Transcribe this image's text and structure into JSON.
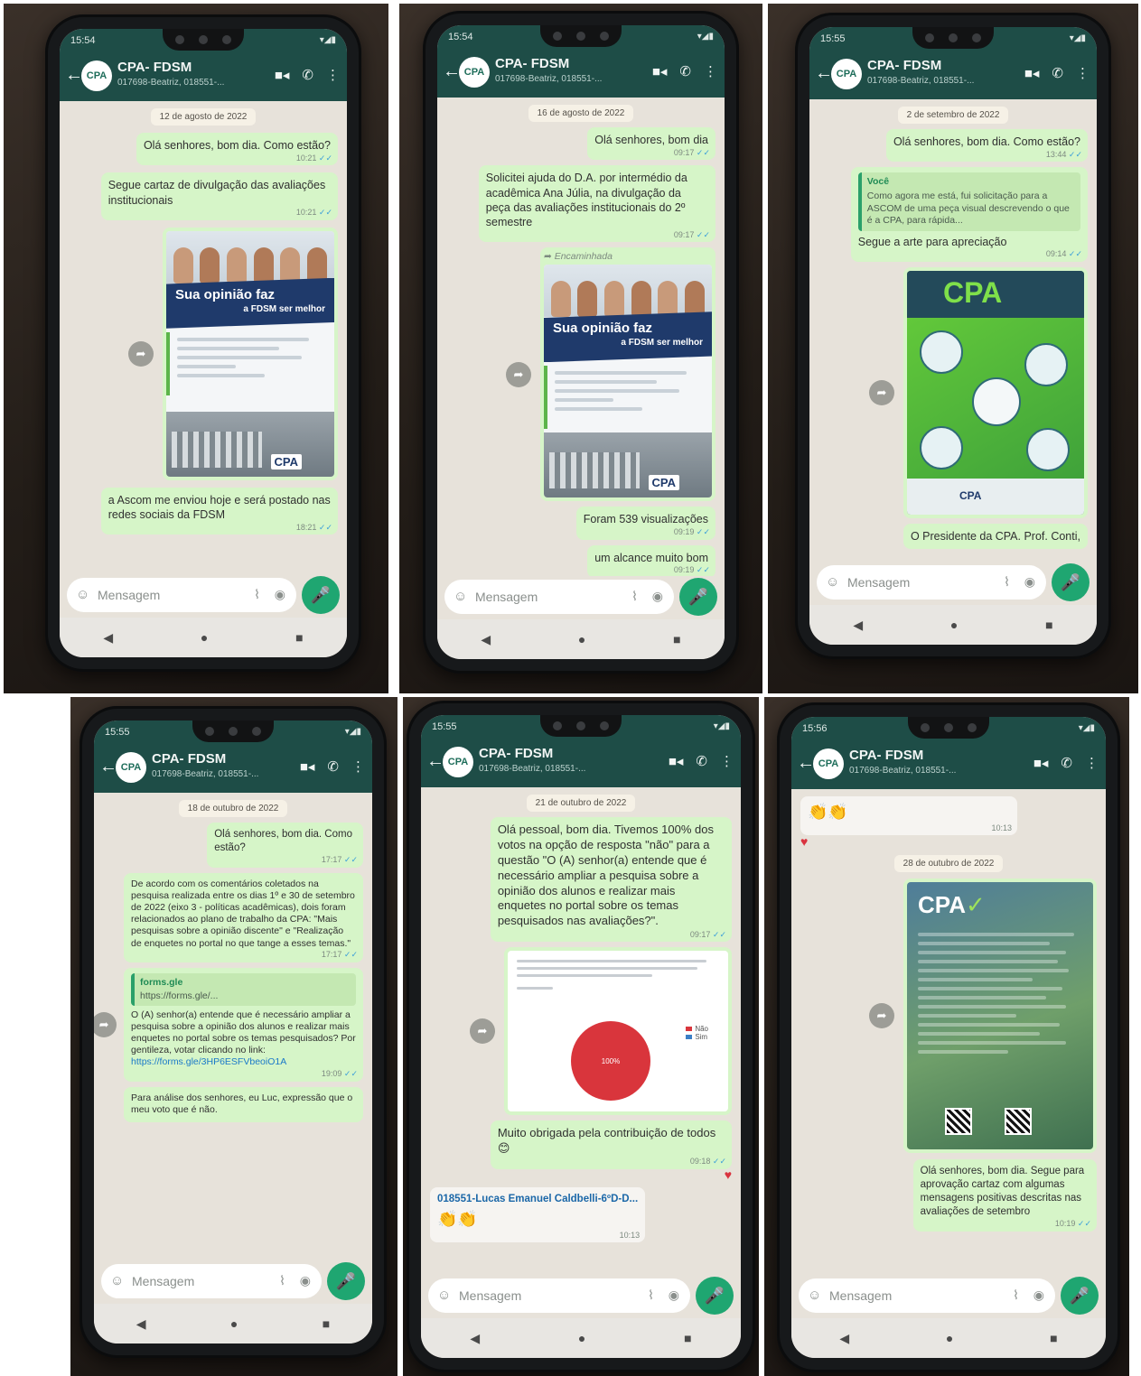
{
  "app": {
    "title": "CPA- FDSM",
    "subtitle": "017698-Beatriz, 018551-...",
    "avatar_text": "CPA",
    "input_placeholder": "Mensagem"
  },
  "icons": {
    "back": "arrow-left-icon",
    "video": "video-camera-icon",
    "call": "phone-icon",
    "menu": "more-vert-icon",
    "emoji": "smiley-icon",
    "attach": "paperclip-icon",
    "camera": "camera-icon",
    "mic": "microphone-icon",
    "share": "forward-share-icon"
  },
  "colors": {
    "header": "#1e4d47",
    "outgoing": "#d6f5c8",
    "mic": "#1fa671",
    "chart_no": "#d9353c",
    "chart_yes": "#3b7fc6"
  },
  "screens": [
    {
      "time": "15:54",
      "date": "12 de agosto de 2022",
      "m1": {
        "text": "Olá senhores, bom dia. Como estão?",
        "time": "10:21"
      },
      "m2": {
        "text": "Segue cartaz de divulgação das avaliações institucionais",
        "time": "10:21"
      },
      "poster": {
        "title": "Sua opinião faz",
        "subtitle": "a FDSM ser melhor",
        "logo": "CPA"
      },
      "m3": {
        "text": "a Ascom me enviou hoje e será postado nas redes sociais da FDSM",
        "time": "18:21"
      }
    },
    {
      "time": "15:54",
      "date": "16 de agosto de 2022",
      "m1": {
        "text": "Olá senhores, bom dia",
        "time": "09:17"
      },
      "m2": {
        "text": "Solicitei ajuda do D.A. por intermédio da acadêmica Ana Júlia, na divulgação da peça das avaliações institucionais do 2º semestre",
        "time": "09:17"
      },
      "forwarded": "Encaminhada",
      "poster": {
        "title": "Sua opinião faz",
        "subtitle": "a FDSM ser melhor",
        "logo": "CPA"
      },
      "m3": {
        "text": "Foram 539 visualizações",
        "time": "09:19"
      },
      "m4": {
        "text": "um alcance muito bom",
        "time": "09:19"
      }
    },
    {
      "time": "15:55",
      "date": "2 de setembro de 2022",
      "m1": {
        "text": "Olá senhores, bom dia. Como estão?",
        "time": "13:44"
      },
      "quote_sender": "Você",
      "quote_text": "Como agora me está, fui solicitação para a ASCOM de uma peça visual descrevendo o que é a CPA, para rápida...",
      "m2": {
        "text": "Segue a arte para apreciação",
        "time": "09:14"
      },
      "poster_word": "CPA",
      "poster_foot": "CPA",
      "m3": {
        "text": "O Presidente da CPA. Prof. Conti,"
      }
    },
    {
      "time": "15:55",
      "date": "18 de outubro de 2022",
      "m1": {
        "text": "Olá senhores, bom dia. Como estão?",
        "time": "17:17"
      },
      "m2": {
        "text": "De acordo com os comentários coletados na pesquisa realizada entre os dias 1º e 30 de setembro de 2022 (eixo 3 - políticas acadêmicas), dois foram relacionados ao plano de trabalho da CPA: \"Mais pesquisas sobre a opinião discente\" e \"Realização de enquetes no portal no que tange a esses temas.\"",
        "time": "17:17"
      },
      "m3_title": "forms.gle",
      "m3_url": "https://forms.gle/...",
      "m3_text": "O (A) senhor(a) entende que é necessário ampliar a pesquisa sobre a opinião dos alunos e realizar mais enquetes no portal sobre os temas pesquisados? Por gentileza, votar clicando no link:",
      "m3_link": "https://forms.gle/3HP6ESFVbeoiO1A",
      "m3_time": "19:09",
      "m4": {
        "text": "Para análise dos senhores, eu Luc, expressão que o meu voto que é não."
      }
    },
    {
      "time": "15:55",
      "date": "21 de outubro de 2022",
      "m1": {
        "text": "Olá pessoal, bom dia. Tivemos 100% dos votos na opção de resposta \"não\" para a questão \"O (A) senhor(a) entende que é necessário ampliar a pesquisa sobre a opinião dos alunos e realizar mais enquetes no portal sobre os temas pesquisados nas avaliações?\".",
        "time": "09:17"
      },
      "chart_time": "09:17",
      "m2": {
        "text": "Muito obrigada pela contribuição de todos 😊",
        "time": "09:18"
      },
      "reply_sender": "018551-Lucas Emanuel Caldbelli-6ºD-D...",
      "reply_text": "👏👏",
      "reply_time": "10:13"
    },
    {
      "time": "15:56",
      "claps": "👏👏",
      "claps_time": "10:13",
      "date": "28 de outubro de 2022",
      "poster_word": "CPA",
      "m1": {
        "text": "Olá senhores, bom dia. Segue para aprovação cartaz com algumas mensagens positivas descritas nas avaliações de setembro",
        "time": "10:19"
      }
    }
  ],
  "chart_data": {
    "type": "pie",
    "categories": [
      "Não",
      "Sim"
    ],
    "values": [
      100,
      0
    ],
    "colors": [
      "#d9353c",
      "#3b7fc6"
    ],
    "labels": [
      "100%"
    ]
  }
}
